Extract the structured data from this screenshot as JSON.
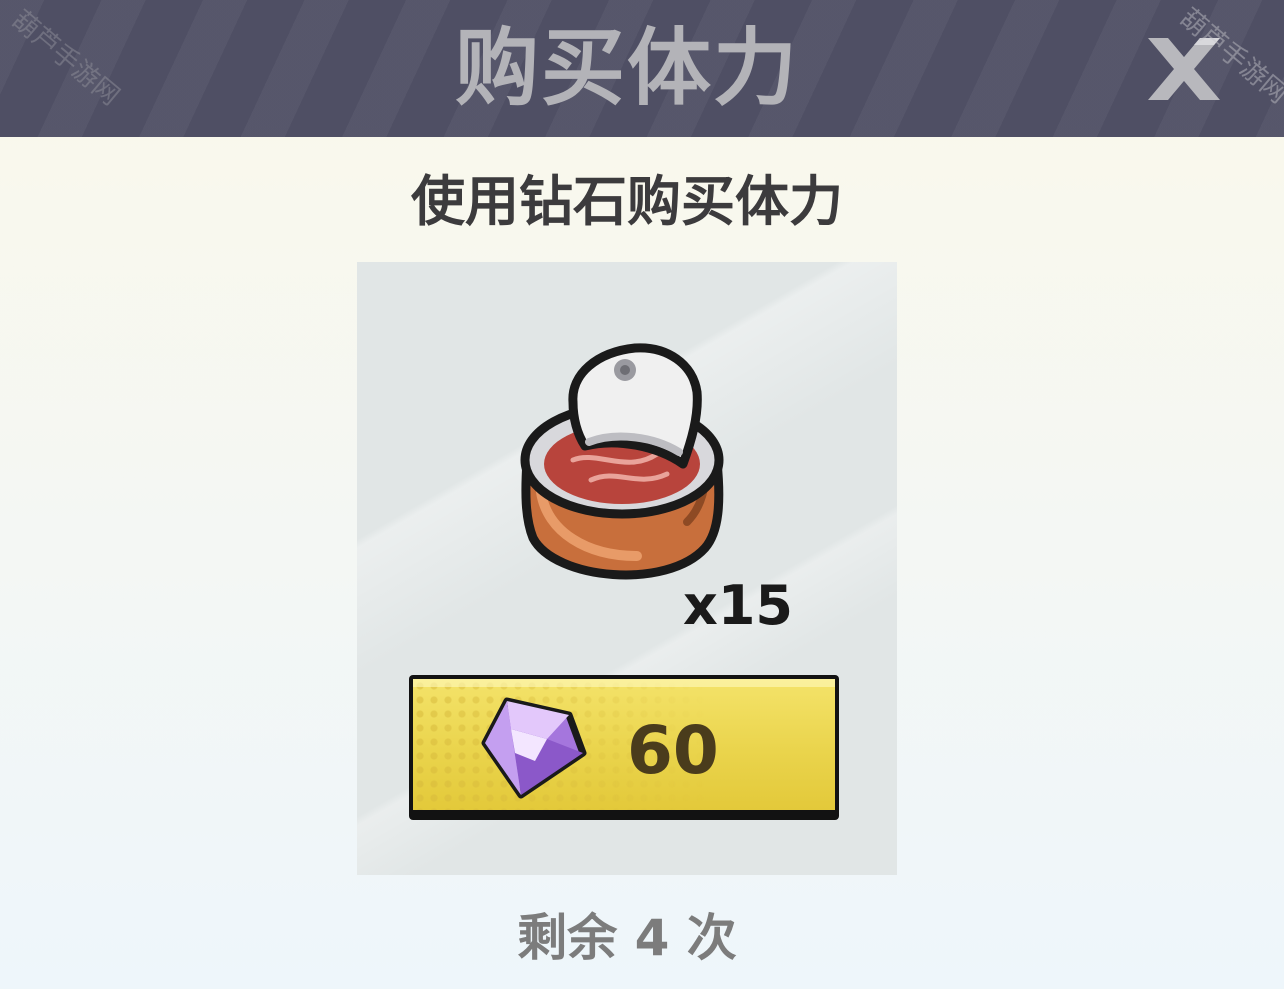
{
  "header": {
    "title": "购买体力"
  },
  "close_icon": "close-x-icon",
  "watermark": "葫芦手游网",
  "dialog": {
    "subtitle": "使用钻石购买体力",
    "item": {
      "icon": "canned-meat-icon",
      "quantity": "x15"
    },
    "buy_button": {
      "icon": "purple-diamond-icon",
      "price": "60"
    },
    "remaining": "剩余 4 次"
  },
  "colors": {
    "header_bg": "#4f4f64",
    "header_text": "#b3b3b8",
    "button_yellow": "#ead44c",
    "gem_purple": "#b88de6",
    "price_text": "#4a3c1c"
  }
}
